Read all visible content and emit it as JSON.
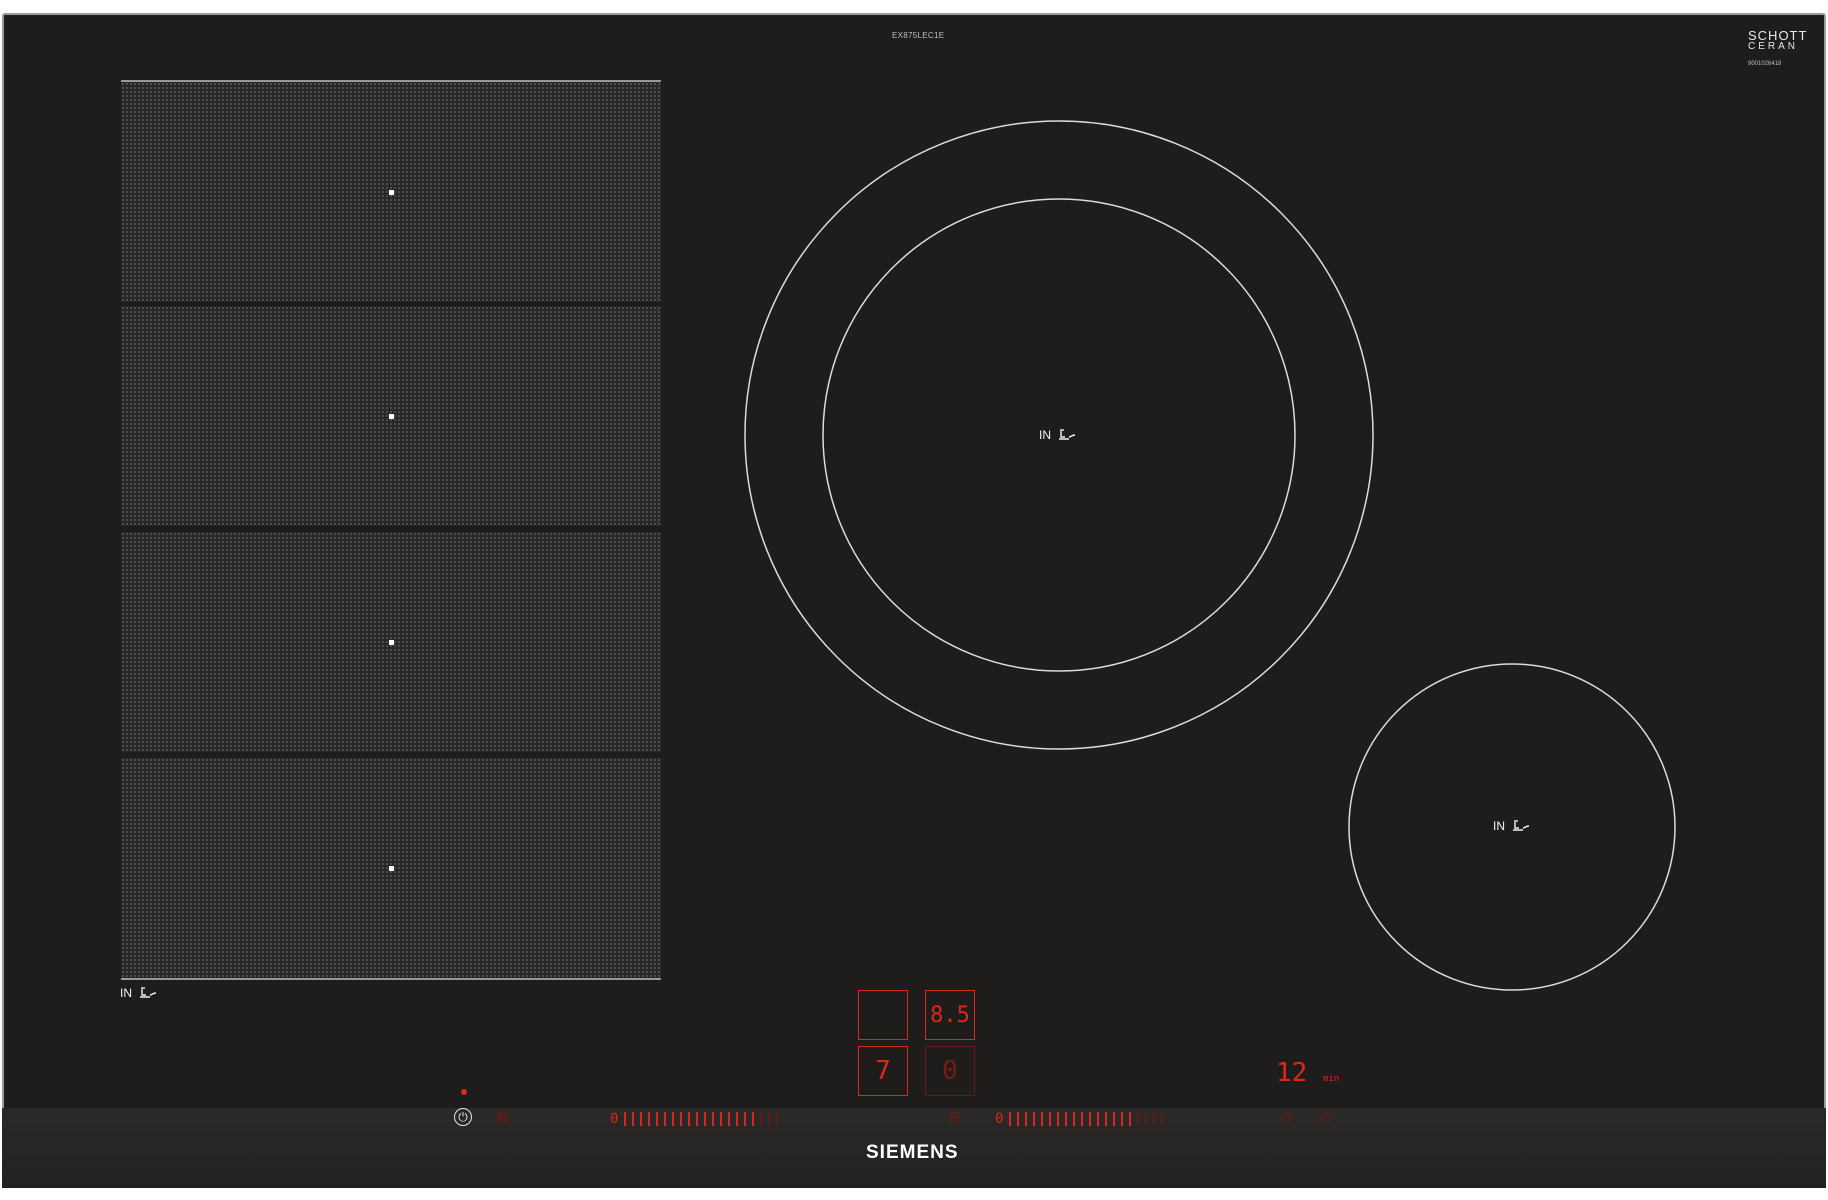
{
  "product": {
    "model_code": "EX875LEC1E",
    "glass_brand_line1": "SCHOTT",
    "glass_brand_line2": "CERAN",
    "serial": "9001026418",
    "brand": "SIEMENS"
  },
  "zones": {
    "flex_label": "IN",
    "large_label": "IN",
    "small_label": "IN"
  },
  "displays": {
    "top_right_value": "8.5",
    "bottom_left_value": "7",
    "bottom_right_value": "0",
    "timer_value": "12",
    "timer_unit": "min"
  },
  "controls": {
    "left_slider_start": "0",
    "right_slider_start": "0"
  },
  "colors": {
    "glass": "#1f1d1c",
    "frame": "#9a9a9a",
    "display_red": "#e0261b"
  }
}
